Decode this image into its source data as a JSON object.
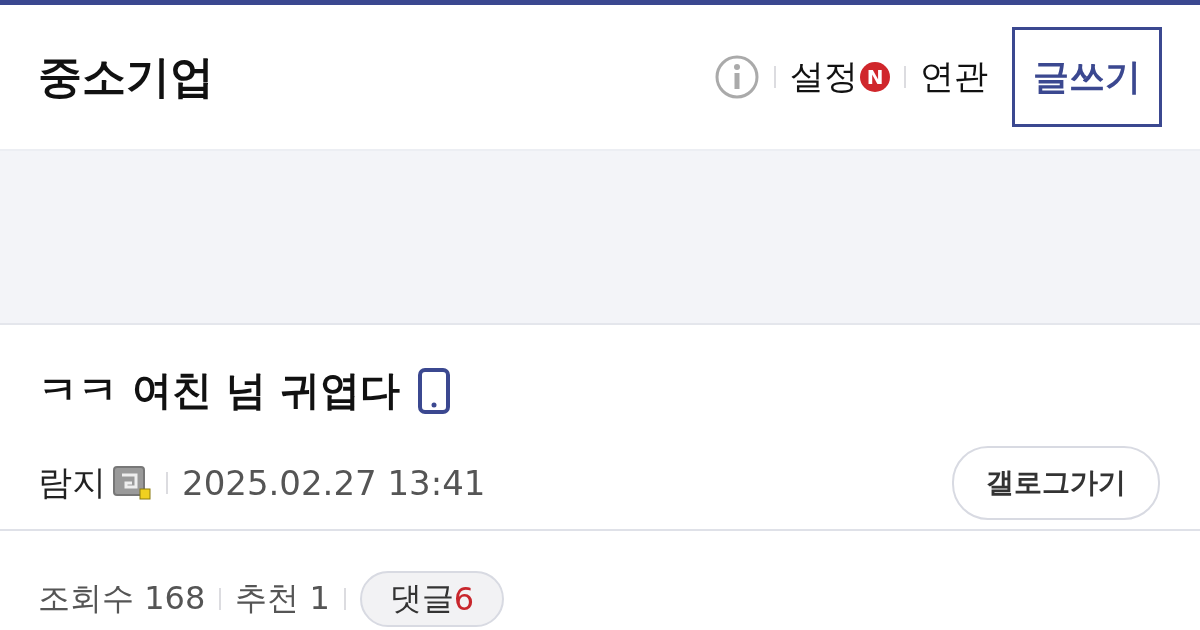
{
  "header": {
    "title": "중소기업",
    "links": [
      {
        "kind": "info"
      },
      {
        "kind": "text",
        "label": "설정",
        "badge": "N"
      },
      {
        "kind": "text",
        "label": "연관"
      }
    ],
    "write_button": "글쓰기"
  },
  "post": {
    "title": "ㅋㅋ 여친 넘 귀엽다",
    "mobile": true,
    "author": "람지",
    "date": "2025.02.27 13:41",
    "gallog_button": "갤로그가기"
  },
  "stats": {
    "views": "조회수 168",
    "recommend": "추천 1",
    "comments_label": "댓글",
    "comments_count": "6"
  }
}
